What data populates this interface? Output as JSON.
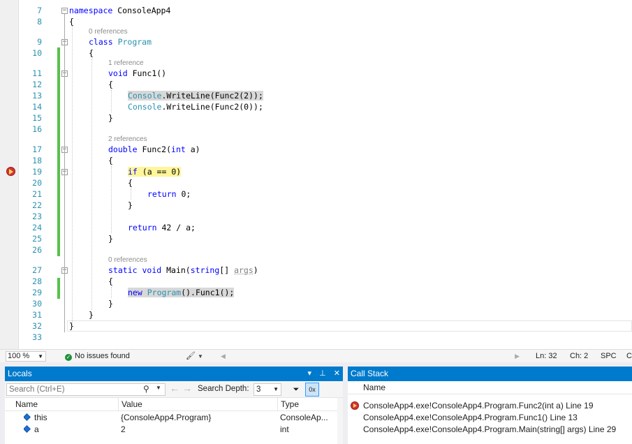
{
  "editor": {
    "lines": [
      {
        "num": "7",
        "code": "namespace ConsoleApp4"
      },
      {
        "num": "8",
        "code": "{"
      },
      {
        "num": "9",
        "lens": "0 references",
        "code": "class Program"
      },
      {
        "num": "10",
        "code": "{"
      },
      {
        "num": "11",
        "lens": "1 reference",
        "code": "void Func1()"
      },
      {
        "num": "12",
        "code": "{"
      },
      {
        "num": "13",
        "code": "Console.WriteLine(Func2(2));"
      },
      {
        "num": "14",
        "code": "Console.WriteLine(Func2(0));"
      },
      {
        "num": "15",
        "code": "}"
      },
      {
        "num": "16",
        "code": ""
      },
      {
        "num": "17",
        "lens": "2 references",
        "code": "double Func2(int a)"
      },
      {
        "num": "18",
        "code": "{"
      },
      {
        "num": "19",
        "code": "if (a == 0)"
      },
      {
        "num": "20",
        "code": "{"
      },
      {
        "num": "21",
        "code": "return 0;"
      },
      {
        "num": "22",
        "code": "}"
      },
      {
        "num": "23",
        "code": ""
      },
      {
        "num": "24",
        "code": "return 42 / a;"
      },
      {
        "num": "25",
        "code": "}"
      },
      {
        "num": "26",
        "code": ""
      },
      {
        "num": "27",
        "lens": "0 references",
        "code": "static void Main(string[] args)"
      },
      {
        "num": "28",
        "code": "{"
      },
      {
        "num": "29",
        "code": "new Program().Func1();"
      },
      {
        "num": "30",
        "code": "}"
      },
      {
        "num": "31",
        "code": "}"
      },
      {
        "num": "32",
        "code": "}"
      },
      {
        "num": "33",
        "code": ""
      }
    ],
    "current_statement_line": "19"
  },
  "status": {
    "zoom": "100 %",
    "issues": "No issues found",
    "line": "Ln: 32",
    "col": "Ch: 2",
    "spacing": "SPC",
    "line_ending": "C"
  },
  "locals": {
    "title": "Locals",
    "search_placeholder": "Search (Ctrl+E)",
    "depth_label": "Search Depth:",
    "depth_value": "3",
    "columns": [
      "Name",
      "Value",
      "Type"
    ],
    "rows": [
      {
        "name": "this",
        "value": "{ConsoleApp4.Program}",
        "type": "ConsoleAp..."
      },
      {
        "name": "a",
        "value": "2",
        "type": "int"
      }
    ]
  },
  "callstack": {
    "title": "Call Stack",
    "column": "Name",
    "frames": [
      "ConsoleApp4.exe!ConsoleApp4.Program.Func2(int a) Line 19",
      "ConsoleApp4.exe!ConsoleApp4.Program.Func1() Line 13",
      "ConsoleApp4.exe!ConsoleApp4.Program.Main(string[] args) Line 29"
    ]
  },
  "colors": {
    "accent": "#007acc",
    "current_statement": "#fff59a",
    "call_highlight": "#d8d8d8",
    "change_bar": "#57c14c",
    "line_number": "#2b91af"
  }
}
